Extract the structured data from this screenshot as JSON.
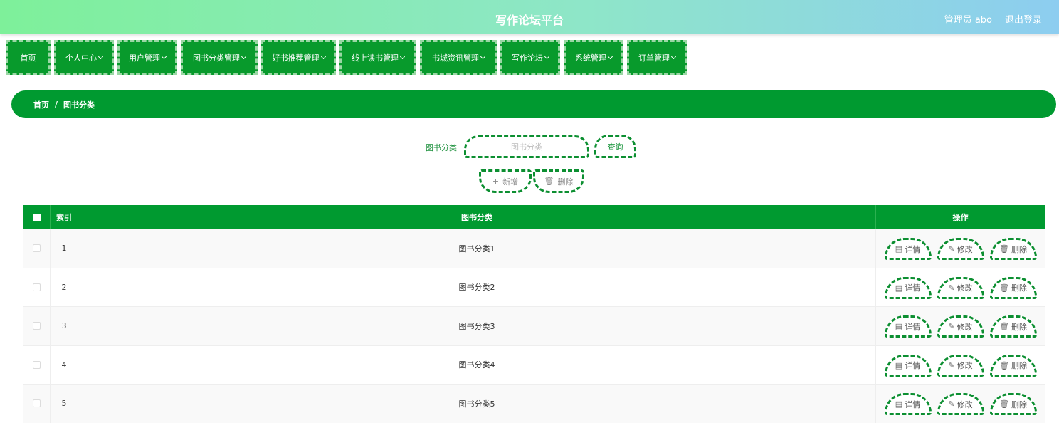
{
  "header": {
    "title": "写作论坛平台",
    "user": "管理员 abo",
    "logout": "退出登录"
  },
  "nav": [
    {
      "label": "首页",
      "dropdown": false
    },
    {
      "label": "个人中心",
      "dropdown": true
    },
    {
      "label": "用户管理",
      "dropdown": true
    },
    {
      "label": "图书分类管理",
      "dropdown": true
    },
    {
      "label": "好书推荐管理",
      "dropdown": true
    },
    {
      "label": "线上读书管理",
      "dropdown": true
    },
    {
      "label": "书城资讯管理",
      "dropdown": true
    },
    {
      "label": "写作论坛",
      "dropdown": true
    },
    {
      "label": "系统管理",
      "dropdown": true
    },
    {
      "label": "订单管理",
      "dropdown": true
    }
  ],
  "breadcrumb": {
    "home": "首页",
    "separator": "/",
    "current": "图书分类"
  },
  "search": {
    "label": "图书分类",
    "placeholder": "图书分类",
    "value": "",
    "query_button": "查询"
  },
  "actions": {
    "add": "新增",
    "add_icon": "+",
    "delete": "删除",
    "delete_icon": "🗑"
  },
  "table": {
    "headers": {
      "index": "索引",
      "name": "图书分类",
      "ops": "操作"
    },
    "rows": [
      {
        "index": "1",
        "name": "图书分类1"
      },
      {
        "index": "2",
        "name": "图书分类2"
      },
      {
        "index": "3",
        "name": "图书分类3"
      },
      {
        "index": "4",
        "name": "图书分类4"
      },
      {
        "index": "5",
        "name": "图书分类5"
      }
    ],
    "row_actions": {
      "detail": "详情",
      "edit": "修改",
      "delete": "删除"
    }
  },
  "colors": {
    "primary": "#009a30",
    "header_gradient_start": "#7ef09a",
    "header_gradient_end": "#8dcdf0"
  }
}
